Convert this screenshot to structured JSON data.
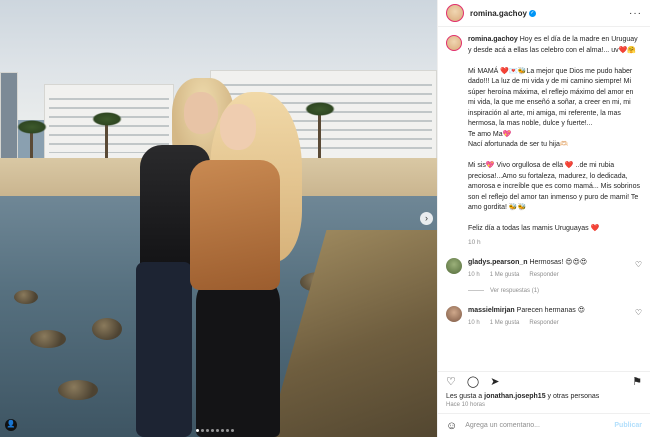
{
  "post": {
    "username": "romina.gachoy",
    "more_icon": "more-horizontal-icon",
    "caption": "Hoy es el día de la madre en Uruguay y desde acá a ellas las celebro con el alma!... uv❤️🤗\n\nMi MAMÁ ❤️💌🐝La mejor que Dios me pudo haber dado!!! La luz de mi vida y de mi camino siempre! Mi súper heroína máxima, el reflejo máximo del amor en mi vida, la que me enseñó a soñar, a creer en mi, mi inspiración al arte, mi amiga, mi referente, la mas hermosa, la mas noble, dulce y fuerte!...\nTe amo Ma💖\nNací afortunada de ser tu hija🫶🏻\n\nMi sis💖 Vivo orgullosa de ella ❤️ ..de mi rubia preciosa!...Amo su fortaleza, madurez, lo dedicada, amorosa e increíble que es como mamá... Mis sobrinos son el reflejo del amor tan inmenso y puro de mami! Te amo gordita! 🐝🐝\n\nFeliz día a todas las mamis Uruguayas ❤️",
    "caption_time": "10 h"
  },
  "comments": [
    {
      "username": "gladys.pearson_n",
      "text": "Hermosas! 😍😍😍",
      "time": "10 h",
      "likes": "1 Me gusta",
      "reply": "Responder",
      "view_replies": "Ver respuestas (1)"
    },
    {
      "username": "massielmirjan",
      "text": "Parecen hermanas 😍",
      "time": "10 h",
      "likes": "1 Me gusta",
      "reply": "Responder"
    }
  ],
  "footer": {
    "likes_prefix": "Les gusta a ",
    "likes_user": "jonathan.joseph15",
    "likes_suffix": " y otras personas",
    "ago": "Hace 10 horas",
    "comment_placeholder": "Agrega un comentario...",
    "publish_label": "Publicar"
  },
  "icons": {
    "like": "heart-icon",
    "comment": "comment-icon",
    "share": "share-icon",
    "save": "bookmark-icon",
    "emoji": "emoji-icon",
    "next": "chevron-right-icon",
    "user_tag": "user-tag-icon"
  },
  "colors": {
    "verified": "#0095f6",
    "secondary_text": "#8e8e8e",
    "publish_disabled": "#b2dffc"
  }
}
